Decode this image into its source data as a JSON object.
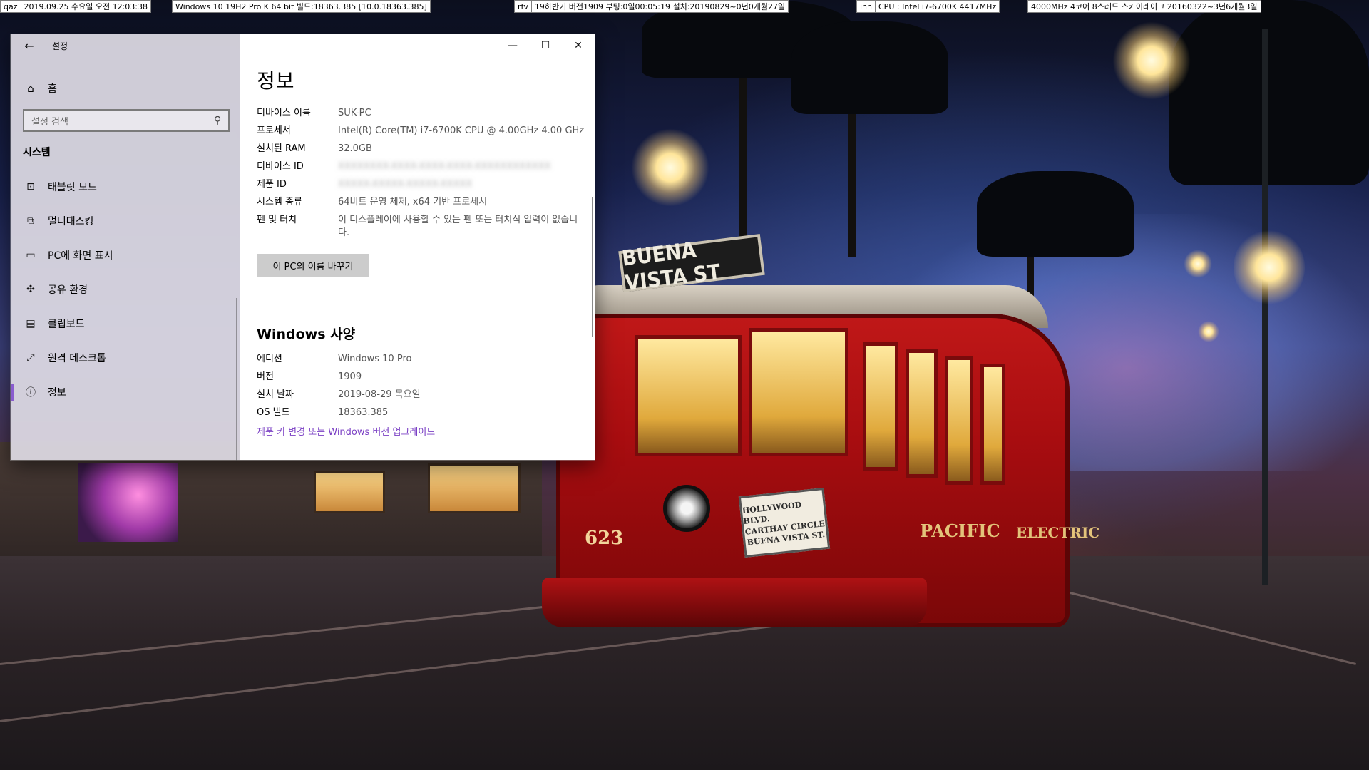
{
  "topbars": [
    {
      "segments": [
        "qaz",
        "2019.09.25 수요일 오전 12:03:38",
        "Windows 10 19H2 Pro K 64 bit 빌드:18363.385 [10.0.18363.385]"
      ]
    },
    {
      "segments": [
        "rfv",
        "19하반기 버전1909 부팅:0일00:05:19 설치:20190829~0년0개월27일"
      ]
    },
    {
      "segments": [
        "ihn",
        "CPU : Intel i7-6700K 4417MHz"
      ]
    },
    {
      "segments": [
        "4000MHz 4코어 8스레드 스카이레이크 20160322~3년6개월3일"
      ]
    }
  ],
  "window": {
    "app_title": "설정",
    "caption": {
      "minimize": "—",
      "maximize": "☐",
      "close": "✕"
    }
  },
  "sidebar": {
    "home_label": "홈",
    "search_placeholder": "설정 검색",
    "section": "시스템",
    "items": [
      {
        "label": "태블릿 모드",
        "icon": "tablet-mode-icon",
        "glyph": "⊡"
      },
      {
        "label": "멀티태스킹",
        "icon": "multitasking-icon",
        "glyph": "⧉"
      },
      {
        "label": "PC에 화면 표시",
        "icon": "project-to-pc-icon",
        "glyph": "▭"
      },
      {
        "label": "공유 환경",
        "icon": "shared-experiences-icon",
        "glyph": "✣"
      },
      {
        "label": "클립보드",
        "icon": "clipboard-icon",
        "glyph": "▤"
      },
      {
        "label": "원격 데스크톱",
        "icon": "remote-desktop-icon",
        "glyph": "⤢"
      },
      {
        "label": "정보",
        "icon": "info-icon",
        "glyph": "ⓘ",
        "active": true
      }
    ]
  },
  "content": {
    "title": "정보",
    "device_specs": [
      {
        "key": "디바이스 이름",
        "value": "SUK-PC"
      },
      {
        "key": "프로세서",
        "value": "Intel(R) Core(TM) i7-6700K CPU @ 4.00GHz    4.00 GHz"
      },
      {
        "key": "설치된 RAM",
        "value": "32.0GB"
      },
      {
        "key": "디바이스 ID",
        "value": "",
        "blurred": true
      },
      {
        "key": "제품 ID",
        "value": "",
        "blurred": true
      },
      {
        "key": "시스템 종류",
        "value": "64비트 운영 체제, x64 기반 프로세서"
      },
      {
        "key": "펜 및 터치",
        "value": "이 디스플레이에 사용할 수 있는 펜 또는 터치식 입력이 없습니다."
      }
    ],
    "rename_button": "이 PC의 이름 바꾸기",
    "windows_spec_title": "Windows 사양",
    "windows_specs": [
      {
        "key": "에디션",
        "value": "Windows 10 Pro"
      },
      {
        "key": "버전",
        "value": "1909"
      },
      {
        "key": "설치 날짜",
        "value": "2019-08-29 목요일"
      },
      {
        "key": "OS 빌드",
        "value": "18363.385"
      }
    ],
    "upgrade_link": "제품 키 변경 또는 Windows 버전 업그레이드"
  },
  "wallpaper": {
    "tram_sign": "BUENA VISTA ST",
    "tram_plaque": [
      "HOLLYWOOD BLVD.",
      "CARTHAY CIRCLE",
      "BUENA VISTA ST."
    ],
    "tram_number": "623",
    "tram_side_words": [
      "PACIFIC",
      "ELECTRIC"
    ]
  },
  "colors": {
    "accent": "#8a5ccf",
    "link": "#7a3fc4",
    "tram_red": "#b01214"
  }
}
